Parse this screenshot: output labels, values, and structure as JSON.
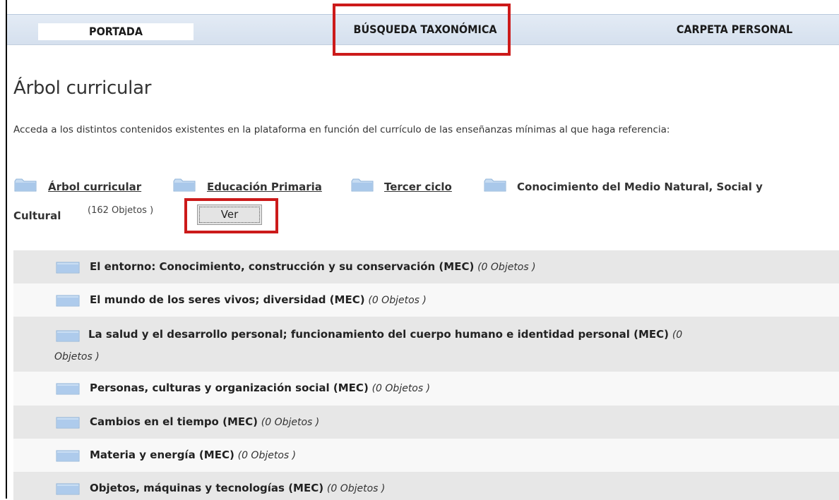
{
  "nav": {
    "portada": "PORTADA",
    "busqueda": "BÚSQUEDA TAXONÓMICA",
    "carpeta": "CARPETA PERSONAL"
  },
  "page": {
    "title": "Árbol curricular",
    "description": "Acceda a los distintos contenidos existentes en la plataforma en función del currículo de las enseñanzas mínimas al que haga referencia:"
  },
  "breadcrumb": {
    "items": [
      "Árbol curricular",
      "Educación Primaria",
      "Tercer ciclo"
    ],
    "current_line1": "Conocimiento del Medio Natural, Social y",
    "current_line2": "Cultural",
    "count": "(162 Objetos )",
    "ver_button": "Ver"
  },
  "categories": [
    {
      "title": "El entorno: Conocimiento, construcción y su conservación (MEC)",
      "count": "(0 Objetos )"
    },
    {
      "title": "El mundo de los seres vivos; diversidad (MEC)",
      "count": "(0 Objetos )"
    },
    {
      "title": "La salud y el desarrollo personal; funcionamiento del cuerpo humano e identidad personal (MEC)",
      "count": "(0",
      "count_line2": "Objetos )"
    },
    {
      "title": "Personas, culturas y organización social (MEC)",
      "count": "(0 Objetos )"
    },
    {
      "title": "Cambios en el tiempo (MEC)",
      "count": "(0 Objetos )"
    },
    {
      "title": "Materia y energía (MEC)",
      "count": "(0 Objetos )"
    },
    {
      "title": "Objetos, máquinas y tecnologías (MEC)",
      "count": "(0 Objetos )"
    }
  ],
  "icons": {
    "folder": "folder-icon",
    "highlight_color": "#cc1a1a"
  }
}
